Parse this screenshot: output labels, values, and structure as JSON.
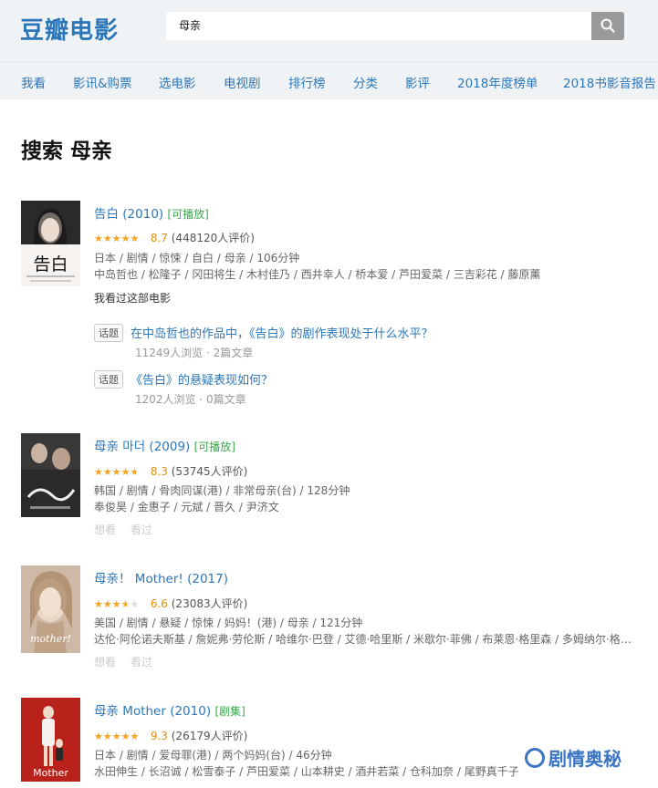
{
  "header": {
    "logo": "豆瓣电影",
    "search_value": "母亲"
  },
  "nav": {
    "items": [
      "我看",
      "影讯&购票",
      "选电影",
      "电视剧",
      "排行榜",
      "分类",
      "影评",
      "2018年度榜单",
      "2018书影音报告"
    ]
  },
  "page": {
    "title": "搜索 母亲"
  },
  "results": [
    {
      "title": "告白 (2010)",
      "badge": "[可播放]",
      "stars_fraction": 0.87,
      "score": "8.7",
      "votes": "(448120人评价)",
      "info": "日本 / 剧情 / 惊悚 / 自白 / 母亲 / 106分钟",
      "cast": "中岛哲也 / 松隆子 / 冈田将生 / 木村佳乃 / 西井幸人 / 桥本爱 / 芦田爱菜 / 三吉彩花 / 藤原薰",
      "status": "我看过这部电影",
      "poster_text": "告白",
      "topics": [
        {
          "tag": "话题",
          "text": "在中岛哲也的作品中，《告白》的剧作表现处于什么水平？",
          "stats": "11249人浏览 · 2篇文章"
        },
        {
          "tag": "话题",
          "text": "《告白》的悬疑表现如何？",
          "stats": "1202人浏览 · 0篇文章"
        }
      ]
    },
    {
      "title": "母亲 마더 (2009)",
      "badge": "[可播放]",
      "stars_fraction": 0.83,
      "score": "8.3",
      "votes": "(53745人评价)",
      "info": "韩国 / 剧情 / 骨肉同谋(港) / 非常母亲(台) / 128分钟",
      "cast": "奉俊昊 / 金惠子 / 元斌 / 晋久 / 尹济文",
      "actions": [
        "想看",
        "看过"
      ]
    },
    {
      "title": "母亲！ Mother! (2017)",
      "badge": "",
      "stars_fraction": 0.66,
      "score": "6.6",
      "votes": "(23083人评价)",
      "info": "美国 / 剧情 / 悬疑 / 惊悚 / 妈妈！(港) / 母亲 / 121分钟",
      "cast": "达伦·阿伦诺夫斯基 / 詹妮弗·劳伦斯 / 哈维尔·巴登 / 艾德·哈里斯 / 米歇尔·菲佛 / 布莱恩·格里森 / 多姆纳尔·格里森",
      "poster_text": "mother!",
      "actions": [
        "想看",
        "看过"
      ]
    },
    {
      "title": "母亲 Mother (2010)",
      "badge": "[剧集]",
      "stars_fraction": 0.93,
      "score": "9.3",
      "votes": "(26179人评价)",
      "info": "日本 / 剧情 / 爱母罪(港) / 两个妈妈(台) / 46分钟",
      "cast": "水田伸生 / 长沼诚 / 松雪泰子 / 芦田爱菜 / 山本耕史 / 酒井若菜 / 仓科加奈 / 尾野真千子",
      "poster_text": "Mother"
    }
  ],
  "watermark": "剧情奥秘",
  "colors": {
    "link": "#2c77b9",
    "play": "#3ba94d",
    "star": "#f5a623",
    "header_bg": "#f0f3f5"
  }
}
